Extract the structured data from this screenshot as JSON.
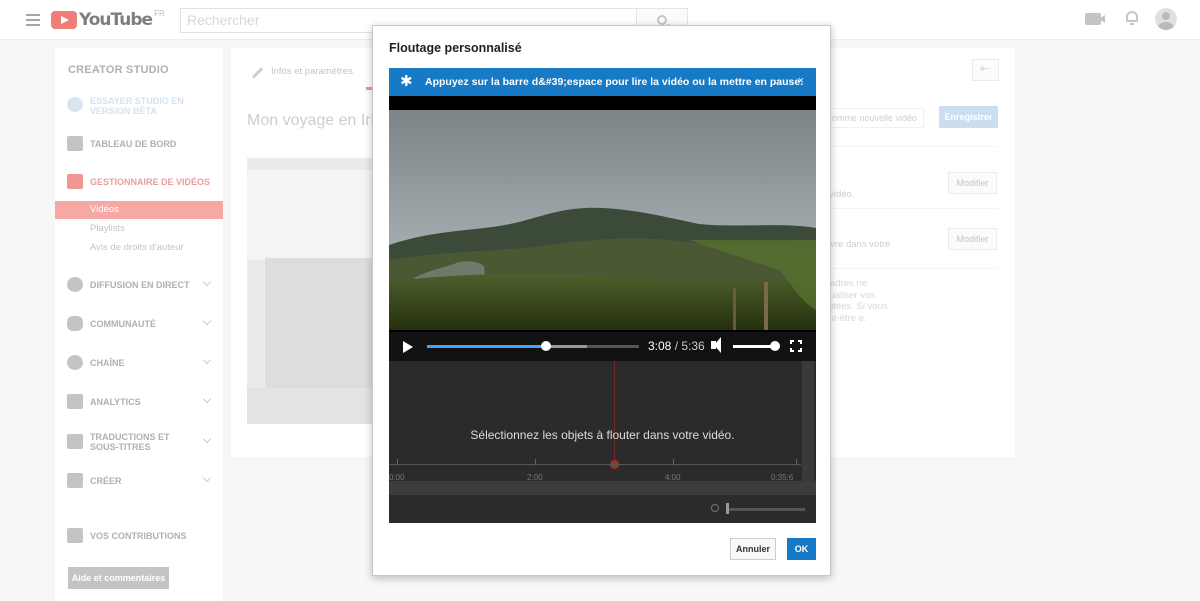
{
  "topbar": {
    "logo_text": "YouTube",
    "country_code": "FR",
    "search_placeholder": "Rechercher"
  },
  "sidebar": {
    "title": "CREATOR STUDIO",
    "beta_label": "ESSAYER STUDIO EN VERSION BÊTA",
    "dashboard_label": "TABLEAU DE BORD",
    "video_manager_label": "GESTIONNAIRE DE VIDÉOS",
    "sub_items": [
      "Vidéos",
      "Playlists",
      "Avis de droits d'auteur"
    ],
    "live_label": "DIFFUSION EN DIRECT",
    "community_label": "COMMUNAUTÉ",
    "channel_label": "CHAÎNE",
    "analytics_label": "ANALYTICS",
    "translations_label": "TRADUCTIONS ET SOUS-TITRES",
    "create_label": "CRÉER",
    "contributions_label": "VOS CONTRIBUTIONS",
    "help_button": "Aide et commentaires"
  },
  "main": {
    "tab_info": "Infos et paramètres",
    "video_title": "Mon voyage en Irlan",
    "save_as_new": "comme nouvelle vidéo",
    "save_button": "Enregistrer",
    "row1_text": "re vidéo.",
    "row2_heading": "s",
    "row2_text": "suivre dans votre",
    "modify_label": "Modifier",
    "note_text": "s cadres ne visualiser vos floutées. Si vous peut-être e."
  },
  "dialog": {
    "title": "Floutage personnalisé",
    "notice": "Appuyez sur la barre d&#39;espace pour lire la vidéo ou la mettre en pause.",
    "close_glyph": "×",
    "player": {
      "current_time": "3:08",
      "duration": "5:36",
      "progress": 0.56
    },
    "timeline_message": "Sélectionnez les objets à flouter dans votre vidéo.",
    "tick_labels": [
      "0:00",
      "2:00",
      "4:00",
      "0:35:6"
    ],
    "cancel_button": "Annuler",
    "ok_button": "OK"
  },
  "colors": {
    "accent_blue": "#167ac6",
    "youtube_red": "#e62117",
    "active_red": "#f06a63"
  }
}
